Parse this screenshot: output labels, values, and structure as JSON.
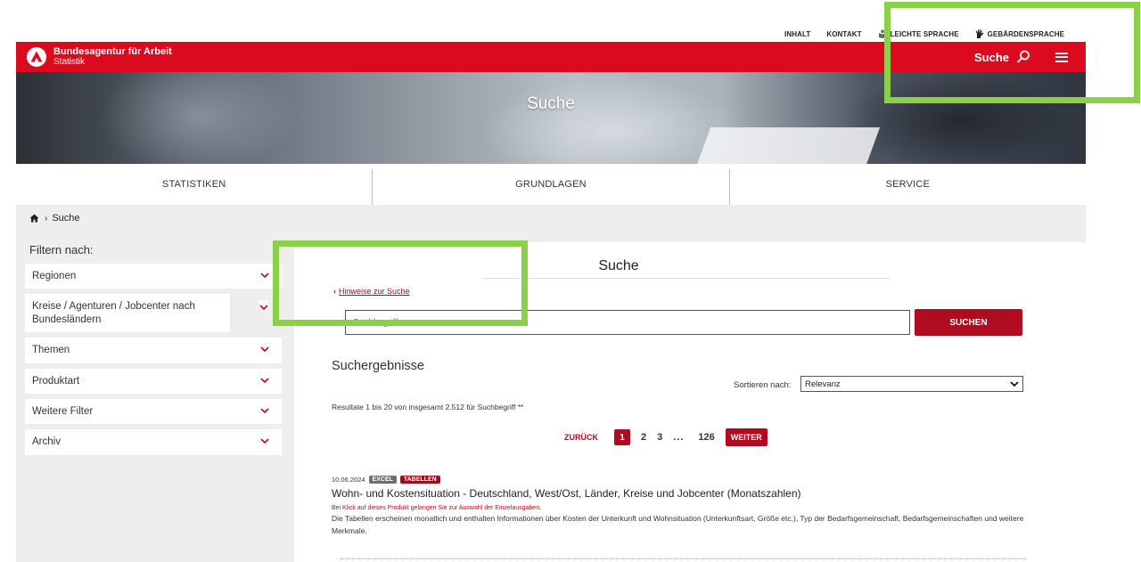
{
  "topbar": {
    "items": [
      "INHALT",
      "KONTAKT",
      "LEICHTE SPRACHE",
      "GEBÄRDENSPRACHE"
    ]
  },
  "header": {
    "brand_name": "Bundesagentur für Arbeit",
    "brand_sub": "Statistik",
    "search_label": "Suche",
    "accent_color": "#dc0a1e"
  },
  "hero": {
    "title": "Suche"
  },
  "nav": {
    "items": [
      "STATISTIKEN",
      "GRUNDLAGEN",
      "SERVICE"
    ]
  },
  "breadcrumb": {
    "current": "Suche"
  },
  "sidebar": {
    "title": "Filtern nach:",
    "facets": [
      "Regionen",
      "Kreise / Agenturen / Jobcenter nach Bundesländern",
      "Themen",
      "Produktart",
      "Weitere Filter",
      "Archiv"
    ]
  },
  "main": {
    "title": "Suche",
    "hint_link": "Hinweise zur Suche",
    "search_placeholder": "Suchbegriff",
    "search_button": "SUCHEN",
    "results_heading": "Suchergebnisse",
    "sort_label": "Sortieren nach:",
    "sort_value": "Relevanz",
    "result_count": "Resultate 1 bis 20 von insgesamt 2.512 für Suchbegriff **",
    "pager": {
      "prev": "ZURÜCK",
      "current": "1",
      "pages": [
        "2",
        "3"
      ],
      "ellipsis": "...",
      "last": "126",
      "next": "WEITER"
    },
    "results": [
      {
        "date": "10.06.2024",
        "badges": [
          "EXCEL",
          "TABELLEN"
        ],
        "title": "Wohn- und Kostensituation - Deutschland, West/Ost, Länder, Kreise und Jobcenter (Monatszahlen)",
        "note": "Bei Klick auf dieses Produkt gelangen Sie zur Auswahl der Einzelausgaben.",
        "description": "Die Tabellen erscheinen monatlich und enthalten Informationen über Kosten der Unterkunft und Wohnsituation (Unterkunftsart, Größe etc.), Typ der Bedarfsgemeinschaft, Bedarfsgemeinschaften und weitere Merkmale."
      }
    ]
  },
  "highlight_color": "#8cd04a"
}
